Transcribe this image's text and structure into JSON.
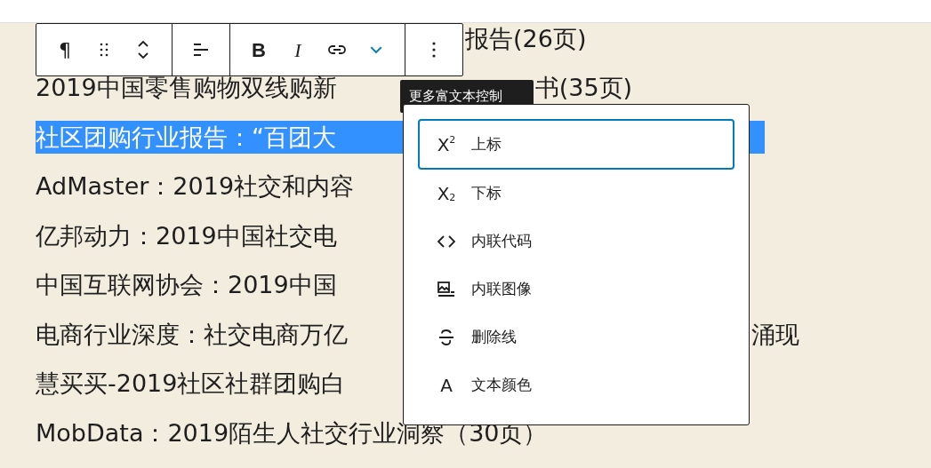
{
  "toolbar": {
    "groups": [
      {
        "buttons": [
          {
            "kind": "paragraph",
            "label": "¶"
          },
          {
            "kind": "drag"
          },
          {
            "kind": "move"
          }
        ]
      },
      {
        "buttons": [
          {
            "kind": "align"
          }
        ]
      },
      {
        "buttons": [
          {
            "kind": "bold",
            "label": "B"
          },
          {
            "kind": "italic",
            "label": "I"
          },
          {
            "kind": "link"
          },
          {
            "kind": "more",
            "expanded": true
          }
        ]
      },
      {
        "buttons": [
          {
            "kind": "options"
          }
        ]
      }
    ]
  },
  "tooltip": "更多富文本控制",
  "lines": [
    {
      "right": "报告(26页)",
      "selected": false
    },
    {
      "left": "2019中国零售购物双线购新",
      "right": "书(35页)",
      "selected": false
    },
    {
      "left": "社区团购行业报告：“百团大",
      "selected": true
    },
    {
      "left": "AdMaster：2019社交和内容",
      "selected": false
    },
    {
      "left": "亿邦动力：2019中国社交电",
      "selected": false
    },
    {
      "left": "中国互联网协会：2019中国",
      "selected": false
    },
    {
      "left": "电商行业深度：社交电商万亿",
      "right": "涌现",
      "selected": false
    },
    {
      "left": "慧买买-2019社区社群团购白",
      "selected": false
    },
    {
      "left": "MobData：2019陌生人社交行业洞察（30页）",
      "selected": false
    }
  ],
  "menu": {
    "items": [
      {
        "kind": "superscript",
        "icon_text": "X$^{2}$",
        "label": "上标",
        "selected": true
      },
      {
        "kind": "subscript",
        "icon_text": "X$_{2}$",
        "label": "下标",
        "selected": false
      },
      {
        "kind": "code",
        "label": "内联代码",
        "selected": false
      },
      {
        "kind": "image",
        "label": "内联图像",
        "selected": false
      },
      {
        "kind": "strikethrough",
        "label": "删除线",
        "selected": false
      },
      {
        "kind": "color",
        "icon_text": "A",
        "label": "文本颜色",
        "selected": false
      }
    ]
  }
}
